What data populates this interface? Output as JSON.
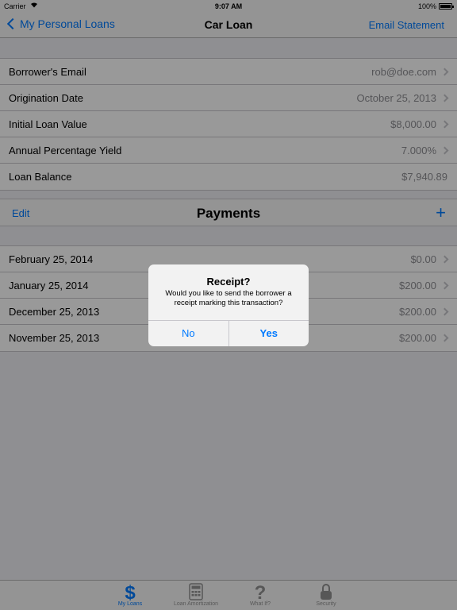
{
  "status": {
    "carrier": "Carrier",
    "time": "9:07 AM",
    "battery": "100%"
  },
  "nav": {
    "back": "My Personal Loans",
    "title": "Car Loan",
    "right": "Email Statement"
  },
  "details": [
    {
      "label": "Borrower's Email",
      "value": "rob@doe.com"
    },
    {
      "label": "Origination Date",
      "value": "October 25, 2013"
    },
    {
      "label": "Initial Loan Value",
      "value": "$8,000.00"
    },
    {
      "label": "Annual Percentage Yield",
      "value": "7.000%"
    },
    {
      "label": "Loan Balance",
      "value": "$7,940.89"
    }
  ],
  "payments_header": {
    "edit": "Edit",
    "title": "Payments",
    "add": "+"
  },
  "payments": [
    {
      "date": "February 25, 2014",
      "amount": "$0.00"
    },
    {
      "date": "January 25, 2014",
      "amount": "$200.00"
    },
    {
      "date": "December 25, 2013",
      "amount": "$200.00"
    },
    {
      "date": "November 25, 2013",
      "amount": "$200.00"
    }
  ],
  "alert": {
    "title": "Receipt?",
    "message": "Would you like to send the borrower a receipt marking this transaction?",
    "no": "No",
    "yes": "Yes"
  },
  "tabs": [
    {
      "label": "My Loans",
      "icon": "dollar-icon",
      "active": true
    },
    {
      "label": "Loan Amortization",
      "icon": "calculator-icon",
      "active": false
    },
    {
      "label": "What If?",
      "icon": "question-icon",
      "active": false
    },
    {
      "label": "Security",
      "icon": "lock-icon",
      "active": false
    }
  ],
  "colors": {
    "accent": "#007aff",
    "secondary_text": "#8e8e93",
    "background": "#efeff4"
  }
}
